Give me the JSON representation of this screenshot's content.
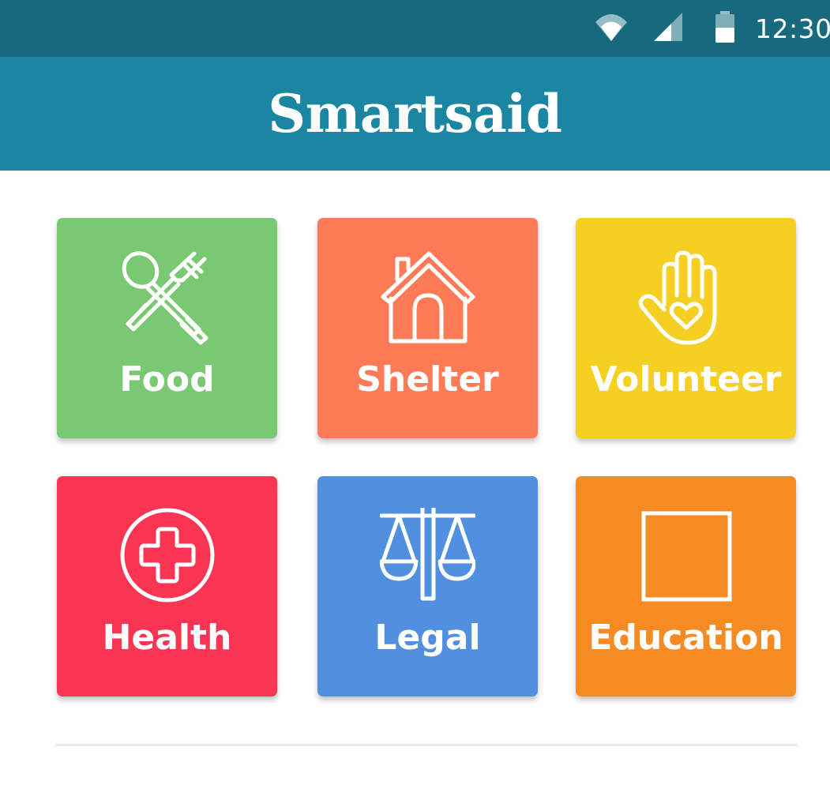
{
  "status_bar": {
    "time": "12:30",
    "icons": [
      "wifi-icon",
      "signal-icon",
      "battery-icon"
    ],
    "background": "#176a7e"
  },
  "app_bar": {
    "title": "Smartsaid",
    "background": "#1b86a2"
  },
  "categories": [
    {
      "label": "Food",
      "icon": "fork-spoon-icon",
      "color": "#79c872"
    },
    {
      "label": "Shelter",
      "icon": "house-icon",
      "color": "#ff7b58"
    },
    {
      "label": "Volunteer",
      "icon": "hand-heart-icon",
      "color": "#f5cf22"
    },
    {
      "label": "Health",
      "icon": "medical-cross-icon",
      "color": "#fa3453"
    },
    {
      "label": "Legal",
      "icon": "scales-icon",
      "color": "#518fe0"
    },
    {
      "label": "Education",
      "icon": "square-icon",
      "color": "#f58b22"
    }
  ]
}
